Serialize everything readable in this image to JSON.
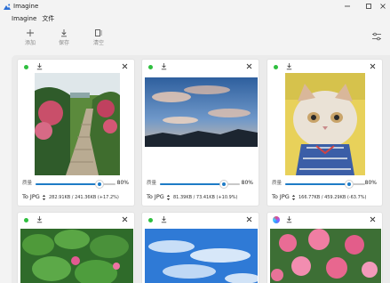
{
  "window": {
    "title": "Imagine"
  },
  "menu": [
    "Imagine",
    "文件"
  ],
  "toolbar": {
    "add_label": "添加",
    "save_label": "保存",
    "clear_label": "清空"
  },
  "cards": [
    {
      "status": "done",
      "quality_label": "质量",
      "quality_value": "80%",
      "quality": 0.8,
      "format": "To JPG",
      "size": "282.91KB / 241.36KB (+17.2%)"
    },
    {
      "status": "done",
      "quality_label": "质量",
      "quality_value": "80%",
      "quality": 0.8,
      "format": "To JPG",
      "size": "81.39KB / 73.41KB (+10.9%)"
    },
    {
      "status": "done",
      "quality_label": "质量",
      "quality_value": "80%",
      "quality": 0.8,
      "format": "To JPG",
      "size": "166.77KB / 459.29KB (-63.7%)"
    },
    {
      "status": "done"
    },
    {
      "status": "done"
    },
    {
      "status": "processing"
    }
  ],
  "colors": {
    "accent": "#1e7bc6",
    "status_ok": "#2fbf3f"
  }
}
